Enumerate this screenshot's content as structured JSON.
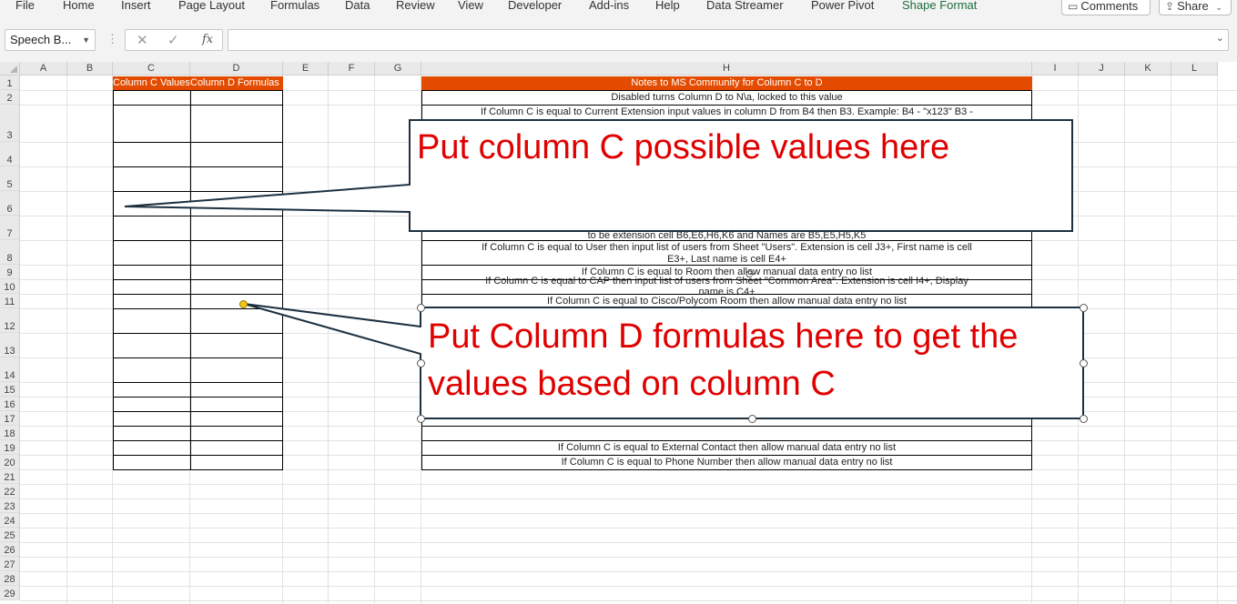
{
  "ribbon": {
    "tabs": [
      "File",
      "Home",
      "Insert",
      "Page Layout",
      "Formulas",
      "Data",
      "Review",
      "View",
      "Developer",
      "Add-ins",
      "Help",
      "Data Streamer",
      "Power Pivot",
      "Shape Format"
    ],
    "active_tab": "Shape Format",
    "comments_label": "Comments",
    "share_label": "Share"
  },
  "formula_bar": {
    "name_box": "Speech B...",
    "formula": ""
  },
  "sheet": {
    "columns": [
      "A",
      "B",
      "C",
      "D",
      "E",
      "F",
      "G",
      "H",
      "I",
      "J",
      "K",
      "L"
    ],
    "rows": [
      "1",
      "2",
      "3",
      "4",
      "5",
      "6",
      "7",
      "8",
      "9",
      "10",
      "11",
      "12",
      "13",
      "14",
      "15",
      "16",
      "17",
      "18",
      "19",
      "20",
      "21",
      "22",
      "23",
      "24",
      "25",
      "26",
      "27",
      "28",
      "29"
    ],
    "c1": "Column C Values",
    "d1": "Column D Formulas",
    "h1": "Notes to MS Community for Column C to D",
    "notes": {
      "h2": "Disabled turns Column D to N\\a, locked to this value",
      "h3": "If Column C is equal to Current Extension input values in column D from B4 then B3. Example: B4 - \"x123\" B3 -",
      "h6": "to be extension cell B6,E6,H6,K6 and Names are B5,E5,H5,K5",
      "h7a": "If Column C is equal to User then input list of users from Sheet \"Users\". Extension is cell J3+, First name is cell",
      "h7b": "E3+, Last name is cell E4+",
      "h9": "If Column C is equal to Room then allow manual data entry no list",
      "h10a": "If Column C is equal to CAP then input list of users from Sheet \"Common Area\". Extension is cell I4+, Display",
      "h10b": "name is C4+",
      "h11": "If Column C is equal to Cisco/Polycom Room then allow manual data entry no list",
      "h19": "If Column C is equal to External Contact then allow manual data entry no list",
      "h20": "If Column C is equal to Phone Number then allow manual data entry no list"
    }
  },
  "callouts": {
    "top": "Put column C possible values here",
    "bottom_line1": "Put Column D formulas here to get the",
    "bottom_line2": "values based on column C"
  },
  "colors": {
    "header_fill": "#e34c00",
    "callout_text": "#e00000",
    "active_tab": "#1d6f3f"
  }
}
